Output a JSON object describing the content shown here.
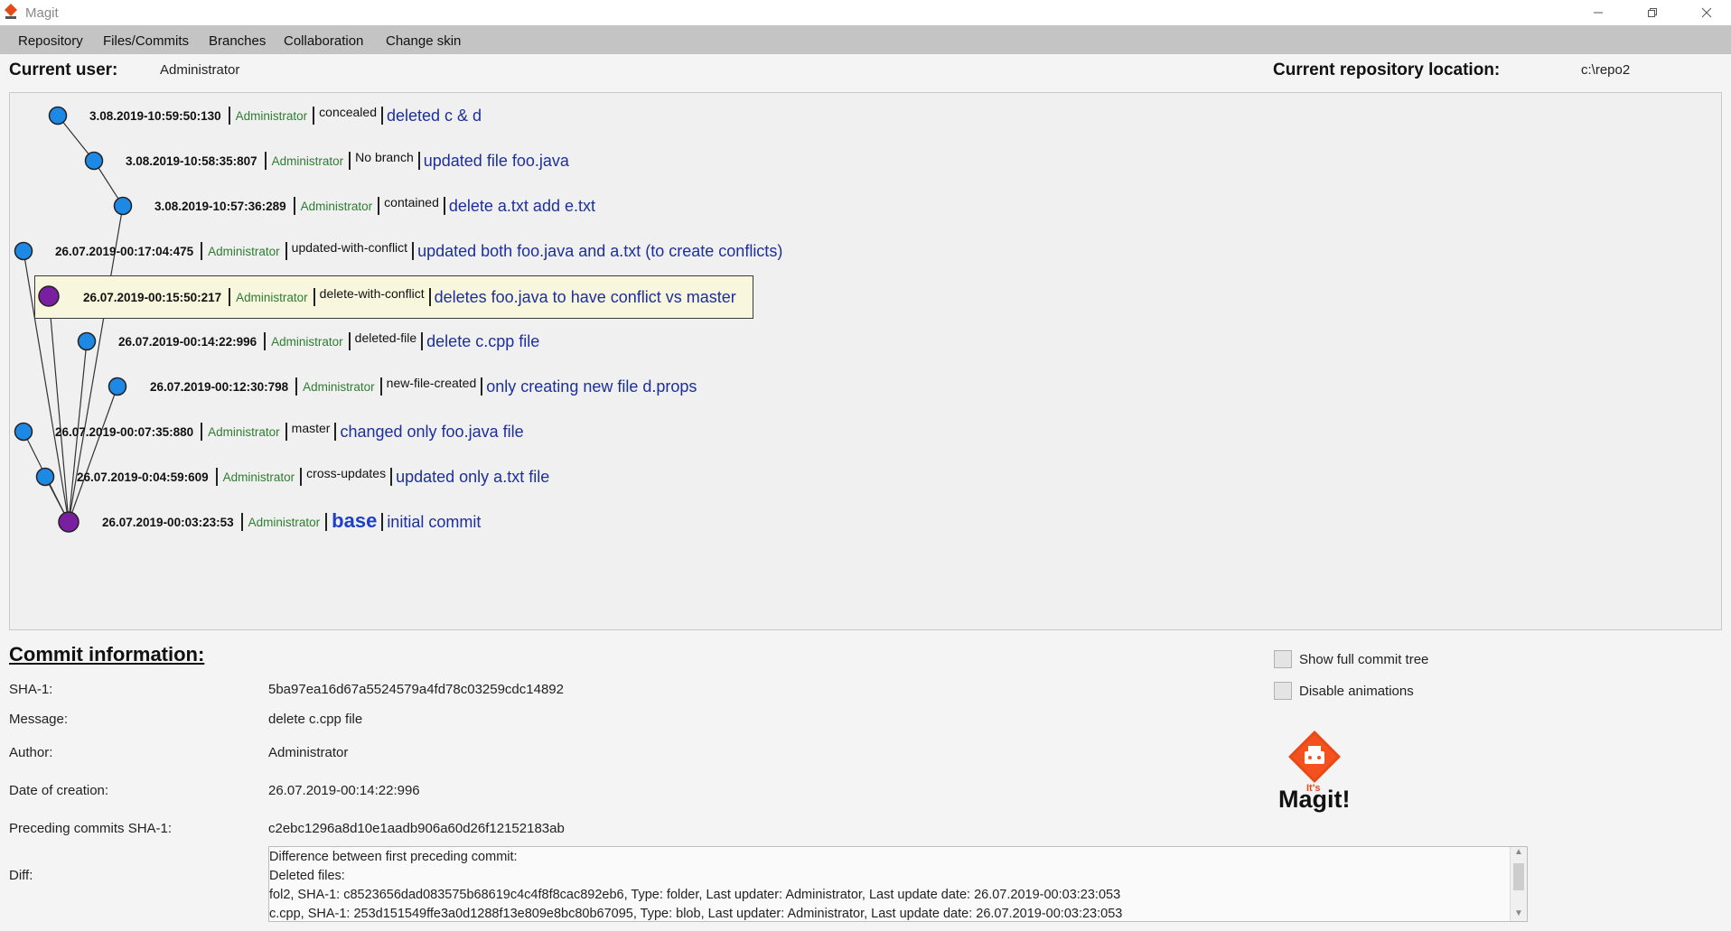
{
  "window": {
    "title": "Magit",
    "controls": [
      "minimize",
      "restore",
      "close"
    ]
  },
  "menu": [
    "Repository",
    "Files/Commits",
    "Branches",
    "Collaboration",
    "Change skin"
  ],
  "header": {
    "user_label": "Current user:",
    "user_value": "Administrator",
    "repo_label": "Current repository location:",
    "repo_value": "c:\\repo2"
  },
  "commits": [
    {
      "date": "3.08.2019-10:59:50:130",
      "author": "Administrator",
      "branch": "concealed",
      "message": "deleted c & d",
      "selected": false
    },
    {
      "date": "3.08.2019-10:58:35:807",
      "author": "Administrator",
      "branch": "No branch",
      "message": "updated file foo.java",
      "selected": false
    },
    {
      "date": "3.08.2019-10:57:36:289",
      "author": "Administrator",
      "branch": "contained",
      "message": "delete a.txt add e.txt",
      "selected": false
    },
    {
      "date": "26.07.2019-00:17:04:475",
      "author": "Administrator",
      "branch": "updated-with-conflict",
      "message": "updated both foo.java and a.txt (to create conflicts)",
      "selected": false
    },
    {
      "date": "26.07.2019-00:15:50:217",
      "author": "Administrator",
      "branch": "delete-with-conflict",
      "message": "deletes foo.java to have conflict vs master",
      "selected": true
    },
    {
      "date": "26.07.2019-00:14:22:996",
      "author": "Administrator",
      "branch": "deleted-file",
      "message": "delete c.cpp file",
      "selected": false
    },
    {
      "date": "26.07.2019-00:12:30:798",
      "author": "Administrator",
      "branch": "new-file-created",
      "message": "only creating new file d.props",
      "selected": false
    },
    {
      "date": "26.07.2019-00:07:35:880",
      "author": "Administrator",
      "branch": "master",
      "message": "changed only foo.java file",
      "selected": false
    },
    {
      "date": "26.07.2019-0:04:59:609",
      "author": "Administrator",
      "branch": "cross-updates",
      "message": "updated only a.txt file",
      "selected": false
    },
    {
      "date": "26.07.2019-00:03:23:53",
      "author": "Administrator",
      "branch": "base",
      "message": "initial commit",
      "selected": false
    }
  ],
  "colors": {
    "node": "#1e88e5",
    "node_head": "#7b1fa2",
    "author": "#2e7d32",
    "message": "#1c2f9c",
    "branch_base": "#1e3fcc"
  },
  "commit_info": {
    "title": "Commit information:",
    "sha_label": "SHA-1:",
    "sha_value": "5ba97ea16d67a5524579a4fd78c03259cdc14892",
    "message_label": "Message:",
    "message_value": "delete c.cpp file",
    "author_label": "Author:",
    "author_value": "Administrator",
    "date_label": "Date of creation:",
    "date_value": "26.07.2019-00:14:22:996",
    "preceding_label": "Preceding commits SHA-1:",
    "preceding_value": "c2ebc1296a8d10e1aadb906a60d26f12152183ab",
    "diff_label": "Diff:",
    "diff_lines": [
      "Difference between first preceding commit:",
      "Deleted files:",
      "fol2, SHA-1: c8523656dad083575b68619c4c4f8f8cac892eb6, Type: folder, Last updater: Administrator, Last update date: 26.07.2019-00:03:23:053",
      "c.cpp, SHA-1: 253d151549ffe3a0d1288f13e809e8bc80b67095, Type: blob, Last updater: Administrator, Last update date: 26.07.2019-00:03:23:053"
    ]
  },
  "options": {
    "show_full_tree": "Show full commit tree",
    "disable_animations": "Disable animations"
  },
  "logo": {
    "small": "It's",
    "big": "Magit!"
  }
}
